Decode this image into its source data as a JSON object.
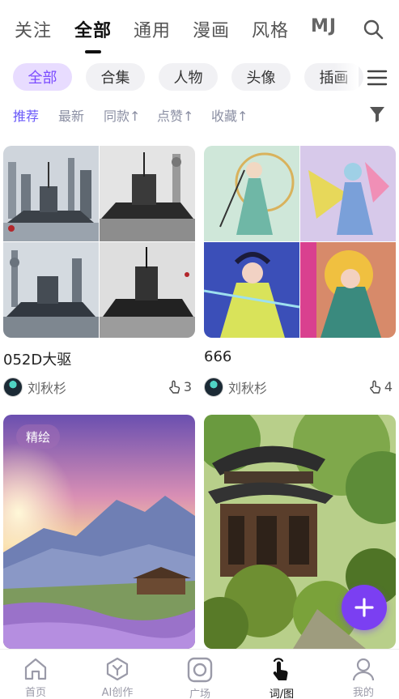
{
  "top_tabs": [
    "关注",
    "全部",
    "通用",
    "漫画",
    "风格",
    "MJ"
  ],
  "categories": [
    "全部",
    "合集",
    "人物",
    "头像",
    "插画"
  ],
  "sorts": [
    "推荐",
    "最新",
    "同款↑",
    "点赞↑",
    "收藏↑"
  ],
  "cards": [
    {
      "title": "052D大驱",
      "author": "刘秋杉",
      "likes": "3"
    },
    {
      "title": "666",
      "author": "刘秋杉",
      "likes": "4"
    },
    {
      "badge": "精绘"
    }
  ],
  "bottom_nav": [
    "首页",
    "AI创作",
    "广场",
    "词/图",
    "我的"
  ],
  "icons": {
    "search": "search-icon",
    "menu": "menu-icon",
    "filter": "filter-icon",
    "like": "like-hand-icon",
    "add": "plus-icon"
  },
  "colors": {
    "accent": "#7c4dff",
    "sort_active": "#6a5af9",
    "fab": "#7b3ff2"
  }
}
